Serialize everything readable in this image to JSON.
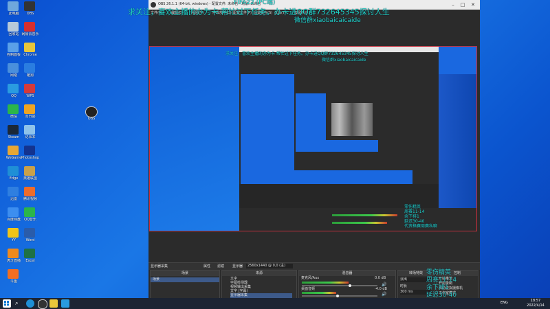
{
  "desktop": {
    "icons": [
      {
        "label": "此电脑",
        "color": "#6fa8dc"
      },
      {
        "label": "回收站",
        "color": "#b7c9d9"
      },
      {
        "label": "控制面板",
        "color": "#5aa0e8"
      },
      {
        "label": "网络",
        "color": "#4a8fdc"
      },
      {
        "label": "QQ",
        "color": "#2a9be0"
      },
      {
        "label": "微信",
        "color": "#2bb54a"
      },
      {
        "label": "Steam",
        "color": "#1b2838"
      },
      {
        "label": "WeGame",
        "color": "#e7a733"
      },
      {
        "label": "Edge",
        "color": "#1f8fd6"
      },
      {
        "label": "迅雷",
        "color": "#2f7fe0"
      },
      {
        "label": "百度网盘",
        "color": "#3c8ef0"
      },
      {
        "label": "YY",
        "color": "#f0c419"
      },
      {
        "label": "虎牙直播",
        "color": "#f08a1d"
      },
      {
        "label": "斗鱼",
        "color": "#f26e21"
      },
      {
        "label": "OBS",
        "color": "#333"
      },
      {
        "label": "网易云音乐",
        "color": "#d62f2f"
      },
      {
        "label": "Chrome",
        "color": "#e8c63a"
      },
      {
        "label": "酷狗",
        "color": "#2a7de0"
      },
      {
        "label": "WPS",
        "color": "#d43a3a"
      },
      {
        "label": "向日葵",
        "color": "#f0a422"
      },
      {
        "label": "记事本",
        "color": "#8fc3ea"
      },
      {
        "label": "Photoshop",
        "color": "#13338f"
      },
      {
        "label": "英雄联盟",
        "color": "#c9a14a"
      },
      {
        "label": "腾讯视频",
        "color": "#ee6c2a"
      },
      {
        "label": "QQ音乐",
        "color": "#2bb54a"
      },
      {
        "label": "Word",
        "color": "#2a5caa"
      },
      {
        "label": "Excel",
        "color": "#1e7145"
      }
    ],
    "selected_icon_label": "OBS"
  },
  "obs": {
    "title": "OBS 26.1.1 (64-bit, windows) - 配置文件: 未命名 - 场景: 未命名",
    "menu": [
      "文件(F)",
      "编辑(E)",
      "视图(V)",
      "停靠部件(D)",
      "配置文件(P)",
      "场景集合(S)",
      "工具(T)",
      "帮助(H)"
    ],
    "overlay": {
      "top_partial": "FIFA22 (PC端)",
      "line1": "求关注，喜欢主播的办为卡 帮忙过下任务。办卡进QQ群732645345探讨人生",
      "line2": "微信群xiaobaicaicaide"
    },
    "source_bar": {
      "label": "显示器采集",
      "props": "属性",
      "filters": "滤镜",
      "display_label": "显示器",
      "display_value": "2560x1440 @ 0,0 (主)"
    },
    "docks": {
      "scenes": {
        "title": "场景",
        "items": [
          "场景"
        ]
      },
      "sources": {
        "title": "来源",
        "items": [
          "文字",
          "字幕检测器",
          "视频输出采集",
          "文字 (字幕)",
          "显示器采集"
        ]
      },
      "mixer": {
        "title": "混音器",
        "channels": [
          {
            "name": "麦克风/Aux",
            "db": "0.0 dB",
            "level": 0.62
          },
          {
            "name": "桌面音频",
            "db": "-4.0 dB",
            "level": 0.45
          }
        ]
      },
      "transition": {
        "title": "转场特效",
        "fade": "淡出",
        "duration_label": "时长",
        "duration": "300 ms"
      },
      "controls": {
        "title": "控制",
        "buttons": [
          "开始推流",
          "开始录制",
          "启动虚拟摄像机",
          "工作室模式",
          "设置",
          "退出"
        ]
      }
    },
    "stats_overlay": [
      "零伤精英",
      "周赛11-14",
      "余下排1",
      "延迟30-40",
      "代资格赛周赛私聊"
    ]
  },
  "taskbar": {
    "search_icon": "search-icon",
    "tray": {
      "lang": "ENG",
      "time": "18:57",
      "date": "2022/4/14"
    }
  }
}
